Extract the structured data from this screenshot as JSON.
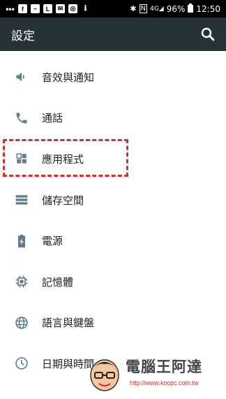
{
  "status_bar": {
    "battery": "96%",
    "time": "12:50"
  },
  "toolbar": {
    "title": "設定",
    "search_icon": "search-icon"
  },
  "settings_items": [
    {
      "label": "音效與通知",
      "icon": "volume-icon"
    },
    {
      "label": "通話",
      "icon": "phone-icon"
    },
    {
      "label": "應用程式",
      "icon": "apps-icon"
    },
    {
      "label": "儲存空間",
      "icon": "storage-icon"
    },
    {
      "label": "電源",
      "icon": "battery-icon"
    },
    {
      "label": "記憶體",
      "icon": "memory-icon"
    },
    {
      "label": "語言與鍵盤",
      "icon": "globe-icon"
    },
    {
      "label": "日期與時間",
      "icon": "clock-icon"
    }
  ],
  "colors": {
    "toolbar": "#263238",
    "icon": "#607d8b",
    "highlight": "#d32f2f"
  },
  "watermark": {
    "text": "電腦王阿達",
    "url": "http://www.kocpc.com.tw"
  }
}
